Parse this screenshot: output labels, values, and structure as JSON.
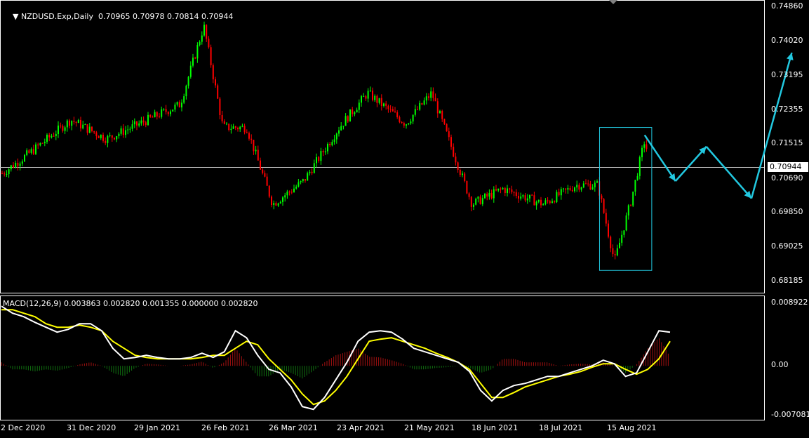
{
  "main_header": {
    "symbol": "NZDUSD.Exp,Daily",
    "ohlc": "0.70965 0.70978 0.70814 0.70944"
  },
  "macd_header": {
    "label": "MACD(12,26,9) 0.003863 0.002820 0.001355 0.000000 0.002820"
  },
  "current_price": "0.70944",
  "price_axis": [
    "0.74860",
    "0.74020",
    "0.73195",
    "0.72355",
    "0.71515",
    "0.70690",
    "0.69850",
    "0.69025",
    "0.68185"
  ],
  "macd_axis": [
    "0.008922",
    "0.00",
    "-0.007081"
  ],
  "date_axis": [
    "2 Dec 2020",
    "31 Dec 2020",
    "29 Jan 2021",
    "26 Feb 2021",
    "26 Mar 2021",
    "23 Apr 2021",
    "21 May 2021",
    "18 Jun 2021",
    "18 Jul 2021",
    "15 Aug 2021"
  ],
  "colors": {
    "background": "#000000",
    "bull_candle": "#00ff00",
    "bear_candle": "#ff0000",
    "macd_line": "#ffffff",
    "signal_line": "#ffff00",
    "hist_pos": "#a01010",
    "hist_neg": "#107010",
    "projection_arrows": "#22c8e0",
    "highlight_box": "#22c8e0",
    "price_line": "#c0c0c0"
  },
  "chart_data": [
    {
      "type": "candlestick",
      "title": "NZDUSD.Exp,Daily",
      "x_range": [
        "2 Dec 2020",
        "31 Aug 2021"
      ],
      "ylim": [
        0.678,
        0.7496
      ],
      "close_series": [
        {
          "date": "2 Dec 2020",
          "close": 0.706
        },
        {
          "date": "15 Dec 2020",
          "close": 0.712
        },
        {
          "date": "31 Dec 2020",
          "close": 0.72
        },
        {
          "date": "15 Jan 2021",
          "close": 0.715
        },
        {
          "date": "29 Jan 2021",
          "close": 0.719
        },
        {
          "date": "15 Feb 2021",
          "close": 0.724
        },
        {
          "date": "25 Feb 2021",
          "close": 0.7445
        },
        {
          "date": "5 Mar 2021",
          "close": 0.718
        },
        {
          "date": "15 Mar 2021",
          "close": 0.718
        },
        {
          "date": "26 Mar 2021",
          "close": 0.698
        },
        {
          "date": "8 Apr 2021",
          "close": 0.704
        },
        {
          "date": "23 Apr 2021",
          "close": 0.718
        },
        {
          "date": "5 May 2021",
          "close": 0.727
        },
        {
          "date": "21 May 2021",
          "close": 0.719
        },
        {
          "date": "1 Jun 2021",
          "close": 0.727
        },
        {
          "date": "18 Jun 2021",
          "close": 0.698
        },
        {
          "date": "1 Jul 2021",
          "close": 0.702
        },
        {
          "date": "18 Jul 2021",
          "close": 0.698
        },
        {
          "date": "1 Aug 2021",
          "close": 0.703
        },
        {
          "date": "10 Aug 2021",
          "close": 0.703
        },
        {
          "date": "17 Aug 2021",
          "close": 0.683
        },
        {
          "date": "24 Aug 2021",
          "close": 0.699
        },
        {
          "date": "30 Aug 2021",
          "close": 0.7155
        },
        {
          "date": "31 Aug 2021",
          "close": 0.70944
        }
      ],
      "annotations": {
        "highlight_box": {
          "from": "11 Aug 2021",
          "to": "2 Sep 2021",
          "price_low": 0.6807,
          "price_high": 0.718
        },
        "projection_path": [
          0.716,
          0.704,
          0.713,
          0.6995,
          0.7375
        ]
      }
    },
    {
      "type": "line",
      "title": "MACD(12,26,9)",
      "ylim": [
        -0.007081,
        0.008922
      ],
      "series": [
        {
          "name": "MACD",
          "values": [
            0.0085,
            0.0075,
            0.007,
            0.0062,
            0.0055,
            0.0048,
            0.0052,
            0.006,
            0.006,
            0.005,
            0.0025,
            0.001,
            0.0012,
            0.0015,
            0.0012,
            0.001,
            0.001,
            0.0012,
            0.0018,
            0.0012,
            0.002,
            0.005,
            0.004,
            0.0015,
            -0.0005,
            -0.001,
            -0.003,
            -0.0058,
            -0.0062,
            -0.0045,
            -0.002,
            0.0005,
            0.0035,
            0.0048,
            0.005,
            0.0048,
            0.0038,
            0.0025,
            0.002,
            0.0015,
            0.001,
            0.0005,
            -0.0008,
            -0.0035,
            -0.005,
            -0.0035,
            -0.0028,
            -0.0025,
            -0.002,
            -0.0015,
            -0.0015,
            -0.001,
            -0.0005,
            0.0,
            0.0008,
            0.0003,
            -0.0015,
            -0.001,
            0.002,
            0.005,
            0.0048
          ]
        },
        {
          "name": "Signal",
          "values": [
            0.008,
            0.008,
            0.0075,
            0.007,
            0.006,
            0.0055,
            0.0055,
            0.0058,
            0.0055,
            0.005,
            0.0035,
            0.0025,
            0.0015,
            0.0012,
            0.001,
            0.001,
            0.001,
            0.001,
            0.0012,
            0.0015,
            0.0015,
            0.0025,
            0.0035,
            0.003,
            0.001,
            -0.0005,
            -0.002,
            -0.004,
            -0.0055,
            -0.005,
            -0.0035,
            -0.0015,
            0.001,
            0.0035,
            0.0038,
            0.004,
            0.0035,
            0.003,
            0.0025,
            0.0018,
            0.0012,
            0.0005,
            -0.0005,
            -0.0025,
            -0.0045,
            -0.0045,
            -0.0038,
            -0.003,
            -0.0025,
            -0.002,
            -0.0015,
            -0.0012,
            -0.0008,
            -0.0002,
            0.0003,
            0.0003,
            -0.0005,
            -0.0012,
            -0.0005,
            0.001,
            0.0035
          ]
        }
      ]
    }
  ]
}
